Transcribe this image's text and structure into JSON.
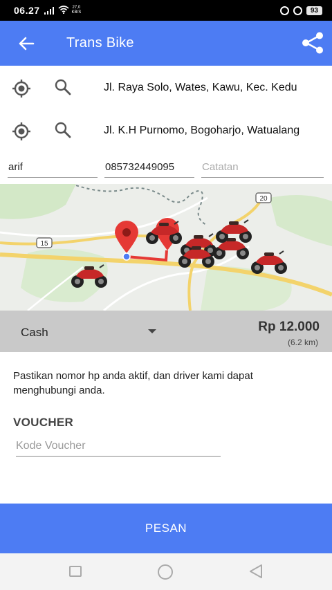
{
  "status_bar": {
    "time": "06.27",
    "network_speed_value": "27,0",
    "network_speed_unit": "KB/S",
    "battery": "93"
  },
  "app_bar": {
    "title": "Trans Bike",
    "back_icon": "arrow-left-icon",
    "share_icon": "share-icon"
  },
  "route": {
    "pickup_address": "Jl. Raya Solo, Wates, Kawu, Kec. Kedu",
    "destination_address": "Jl. K.H Purnomo, Bogoharjo, Watualang"
  },
  "form": {
    "name": "arif",
    "phone": "085732449095",
    "note_placeholder": "Catatan"
  },
  "map": {
    "road_badges": [
      "15",
      "20"
    ],
    "road_color": "#f3d36b",
    "route_color": "#e53935",
    "pin_color": "#e53935"
  },
  "payment": {
    "method": "Cash",
    "price": "Rp 12.000",
    "distance": "(6.2 km)"
  },
  "notice": "Pastikan nomor hp anda aktif, dan driver kami dapat menghubungi anda.",
  "voucher": {
    "heading": "VOUCHER",
    "placeholder": "Kode Voucher"
  },
  "order_button": "PESAN",
  "colors": {
    "primary": "#4d7cf3",
    "payment_bar": "#c9c9c9"
  }
}
